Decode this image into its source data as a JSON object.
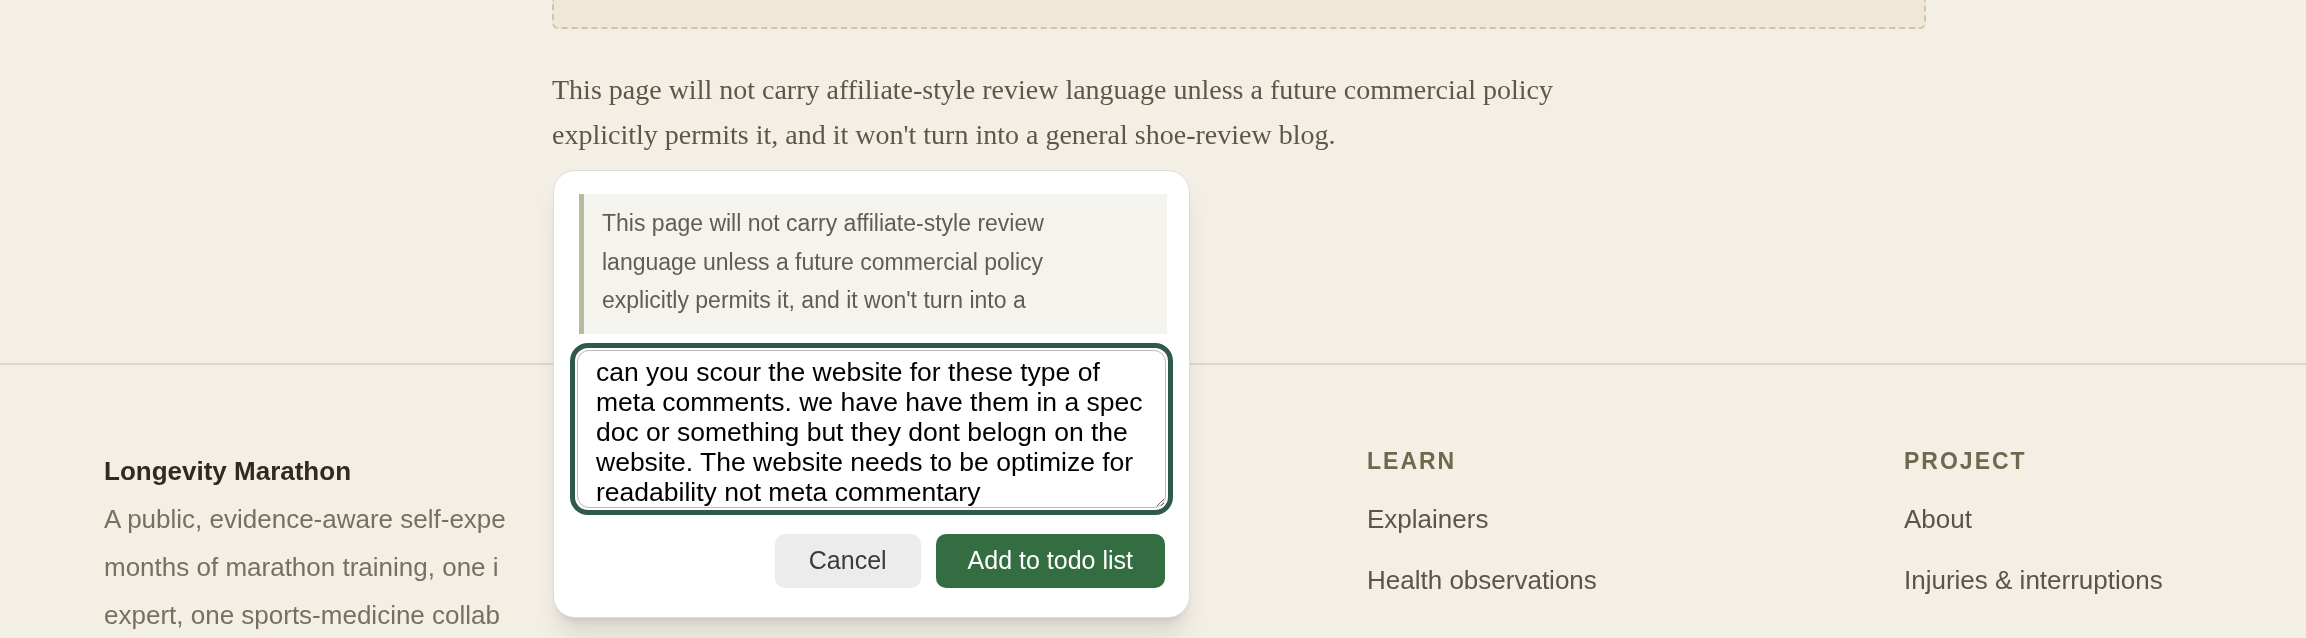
{
  "article": {
    "paragraph": "This page will not carry affiliate-style review language unless a future commercial policy explicitly permits it, and it won't turn into a general shoe-review blog."
  },
  "comment_popup": {
    "quote_lines": [
      "This page will not carry affiliate-style review",
      "language unless a future commercial policy",
      "explicitly permits it, and it won't turn into a"
    ],
    "comment_value": "can you scour the website for these type of meta comments. we have have them in a spec doc or something but they dont belogn on the website. The website needs to be optimize for readability not meta commentary",
    "buttons": [
      {
        "kind": "secondary",
        "label": "Cancel"
      },
      {
        "kind": "primary",
        "label": "Add to todo list"
      }
    ]
  },
  "footer": {
    "brand": "Longevity Marathon",
    "description_lines": [
      "A public, evidence-aware self-expe",
      "months of marathon training, one i",
      "expert, one sports-medicine collab"
    ],
    "columns": [
      {
        "heading": "LEARN",
        "links": [
          "Explainers",
          "Health observations"
        ]
      },
      {
        "heading": "PROJECT",
        "links": [
          "About",
          "Injuries & interruptions"
        ]
      }
    ]
  }
}
